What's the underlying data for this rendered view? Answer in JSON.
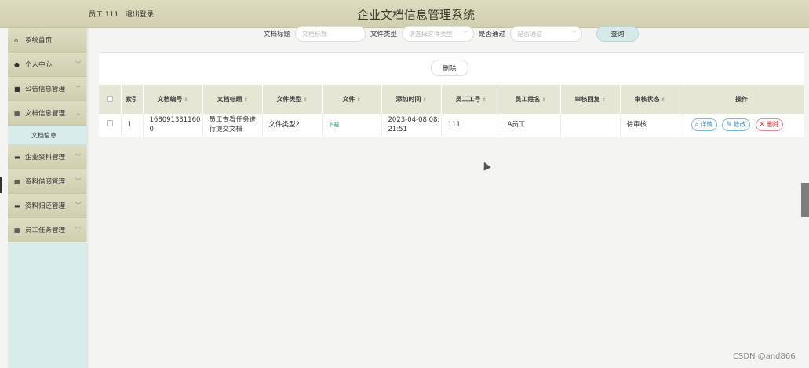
{
  "header": {
    "user": "员工 111",
    "logout": "退出登录",
    "title": "企业文档信息管理系统"
  },
  "sidebar": {
    "items": [
      {
        "label": "系统首页",
        "icon": "home-icon",
        "glyph": "⌂",
        "chevron": ""
      },
      {
        "label": "个人中心",
        "icon": "user-icon",
        "glyph": "●",
        "chevron": "﹀"
      },
      {
        "label": "公告信息管理",
        "icon": "notice-icon",
        "glyph": "■",
        "chevron": "﹀"
      },
      {
        "label": "文档信息管理",
        "icon": "grid-icon",
        "glyph": "▦",
        "chevron": "︿"
      },
      {
        "label": "文档信息",
        "sub": true
      },
      {
        "label": "企业资料管理",
        "icon": "monitor-icon",
        "glyph": "▬",
        "chevron": "﹀"
      },
      {
        "label": "资料借阅管理",
        "icon": "grid-icon",
        "glyph": "▦",
        "chevron": "﹀"
      },
      {
        "label": "资料归还管理",
        "icon": "card-icon",
        "glyph": "▬",
        "chevron": "﹀"
      },
      {
        "label": "员工任务管理",
        "icon": "grid-icon",
        "glyph": "▦",
        "chevron": "﹀"
      }
    ]
  },
  "search": {
    "title_label": "文档标题",
    "title_placeholder": "文档标题",
    "type_label": "文件类型",
    "type_placeholder": "请选择文件类型",
    "pass_label": "是否通过",
    "pass_placeholder": "是否通过",
    "button": "查询"
  },
  "actions": {
    "delete": "删除"
  },
  "table": {
    "headers": [
      "索引",
      "文档编号",
      "文档标题",
      "文件类型",
      "文件",
      "添加时间",
      "员工工号",
      "员工姓名",
      "审核回复",
      "审核状态",
      "操作"
    ],
    "rows": [
      {
        "index": "1",
        "doc_no": "1680913311600",
        "title": "员工查看任务进行提交文档",
        "type": "文件类型2",
        "file": "下载",
        "time": "2023-04-08 08:21:51",
        "emp_no": "111",
        "emp_name": "A员工",
        "reply": "",
        "status": "待审核",
        "ops": {
          "detail": "详情",
          "edit": "修改",
          "del": "删除"
        }
      }
    ]
  },
  "watermark": "CSDN @and866"
}
